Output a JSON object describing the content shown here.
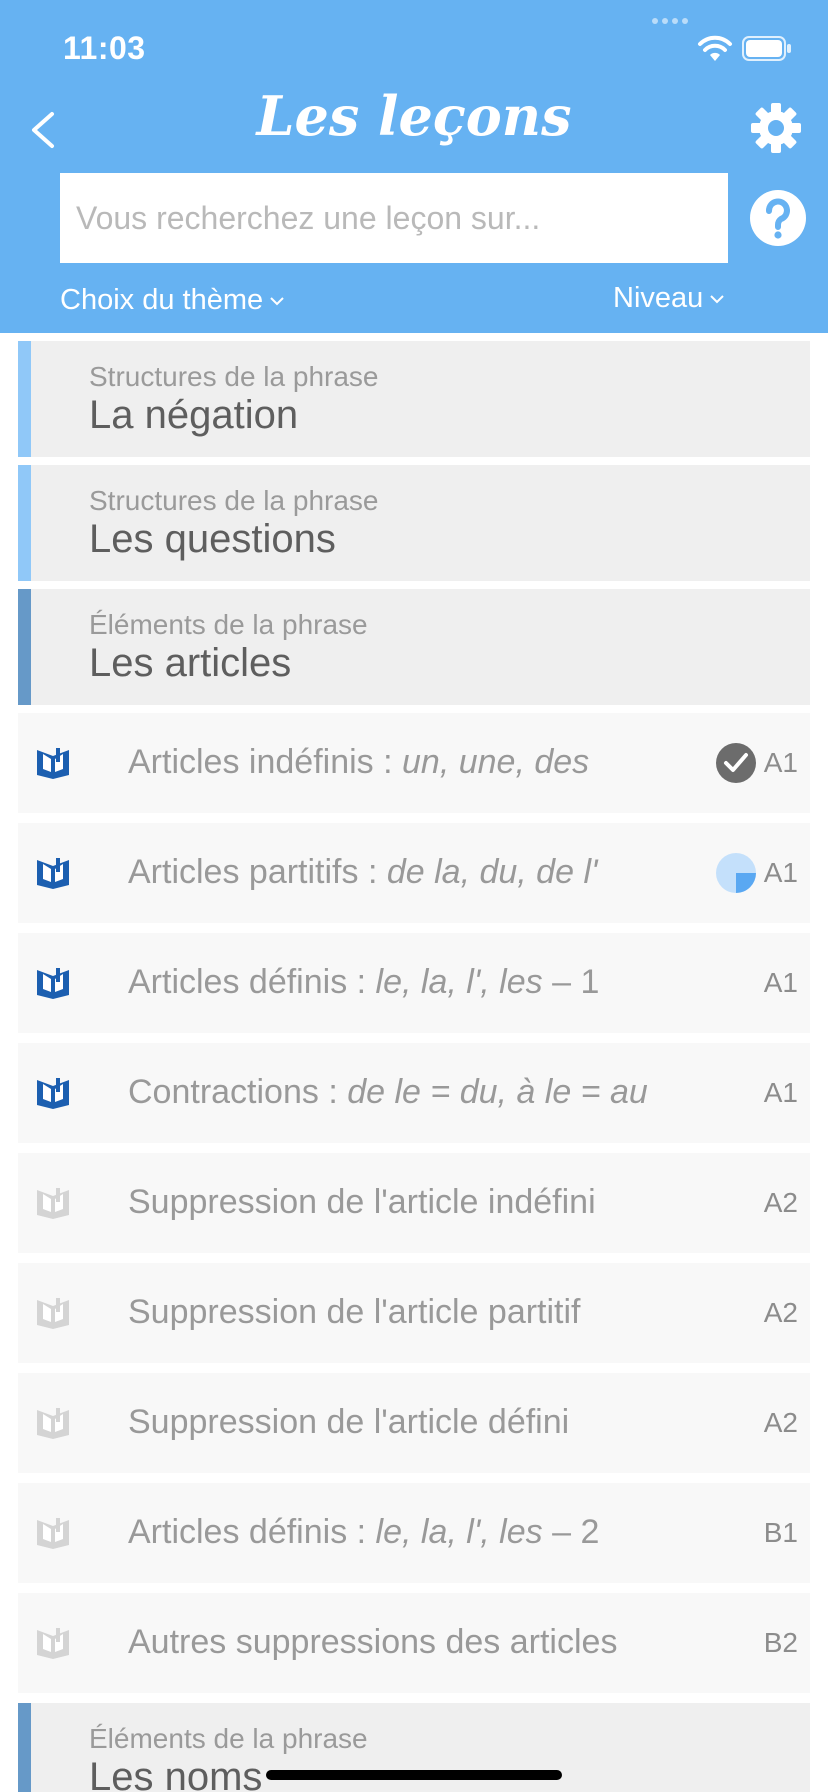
{
  "status_bar": {
    "time": "11:03"
  },
  "header": {
    "title": "Les leçons",
    "search_placeholder": "Vous recherchez une leçon sur...",
    "theme_filter": "Choix du thème",
    "level_filter": "Niveau",
    "accent_color": "#66b2f2"
  },
  "sections": [
    {
      "category": "Structures de la phrase",
      "title": "La négation",
      "bar_color": "#90c8f8"
    },
    {
      "category": "Structures de la phrase",
      "title": "Les questions",
      "bar_color": "#90c8f8"
    },
    {
      "category": "Éléments de la phrase",
      "title": "Les articles",
      "bar_color": "#6699c8"
    }
  ],
  "lessons": [
    {
      "title": "Articles indéfinis : ",
      "examples": "un, une, des",
      "suffix": "",
      "level": "A1",
      "status": "completed",
      "unlocked": true
    },
    {
      "title": "Articles partitifs : ",
      "examples": "de la, du, de l'",
      "suffix": "",
      "level": "A1",
      "status": "in-progress",
      "progress": 0.25,
      "unlocked": true
    },
    {
      "title": "Articles définis : ",
      "examples": "le, la, l', les",
      "suffix": " – 1",
      "level": "A1",
      "status": "none",
      "unlocked": true
    },
    {
      "title": "Contractions : ",
      "examples": "de le = du, à le = au",
      "suffix": "",
      "level": "A1",
      "status": "none",
      "unlocked": true
    },
    {
      "title": "Suppression de l'article indéfini",
      "examples": "",
      "suffix": "",
      "level": "A2",
      "status": "none",
      "unlocked": false
    },
    {
      "title": "Suppression de l'article partitif",
      "examples": "",
      "suffix": "",
      "level": "A2",
      "status": "none",
      "unlocked": false
    },
    {
      "title": "Suppression de l'article défini",
      "examples": "",
      "suffix": "",
      "level": "A2",
      "status": "none",
      "unlocked": false
    },
    {
      "title": "Articles définis : ",
      "examples": "le, la, l', les",
      "suffix": " – 2",
      "level": "B1",
      "status": "none",
      "unlocked": false
    },
    {
      "title": "Autres suppressions des articles",
      "examples": "",
      "suffix": "",
      "level": "B2",
      "status": "none",
      "unlocked": false
    }
  ],
  "next_section": {
    "category": "Éléments de la phrase",
    "title": "Les noms",
    "bar_color": "#6699c8"
  }
}
